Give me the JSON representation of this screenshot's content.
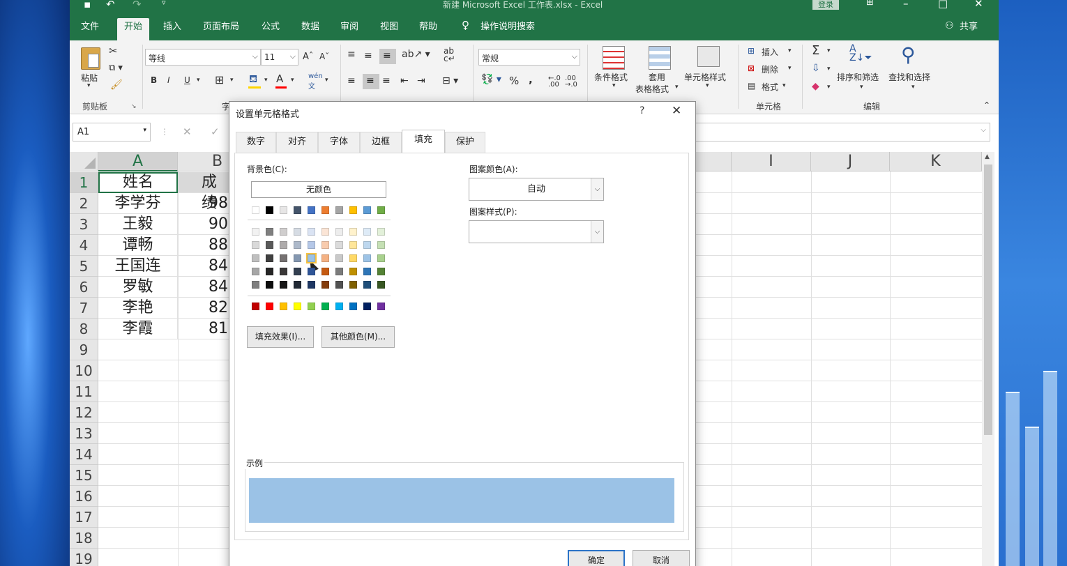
{
  "window": {
    "title": "新建 Microsoft Excel 工作表.xlsx  -  Excel",
    "login": "登录",
    "qat_icons": [
      "save-icon",
      "undo-icon",
      "redo-icon",
      "customize-qat-icon"
    ],
    "controls": [
      "ribbon-display-icon",
      "minimize-icon",
      "maximize-icon",
      "close-icon"
    ]
  },
  "menu": {
    "tabs": [
      "文件",
      "开始",
      "插入",
      "页面布局",
      "公式",
      "数据",
      "审阅",
      "视图",
      "帮助"
    ],
    "active_tab": "开始",
    "tell_me": "操作说明搜索",
    "share": "共享"
  },
  "ribbon": {
    "clipboard": {
      "paste": "粘贴",
      "label": "剪贴板"
    },
    "font": {
      "name": "等线",
      "size": "11",
      "bold": "B",
      "italic": "I",
      "underline": "U"
    },
    "number": {
      "format": "常规",
      "percent": "%",
      "comma": ","
    },
    "styles": {
      "conditional": "条件格式",
      "table_line1": "套用",
      "table_line2": "表格格式",
      "cell_styles": "单元格样式"
    },
    "cells": {
      "insert": "插入",
      "delete": "删除",
      "format": "格式",
      "label": "单元格"
    },
    "editing": {
      "sort_filter": "排序和筛选",
      "find_select": "查找和选择",
      "label": "编辑"
    },
    "partial_label": "字"
  },
  "formula_bar": {
    "name_box": "A1",
    "cancel": "✕",
    "enter": "✓"
  },
  "sheet": {
    "left_columns": [
      "A",
      "B"
    ],
    "right_columns": [
      "I",
      "J",
      "K"
    ],
    "rows": [
      "1",
      "2",
      "3",
      "4",
      "5",
      "6",
      "7",
      "8",
      "9",
      "10",
      "11",
      "12",
      "13",
      "14",
      "15",
      "16",
      "17",
      "18",
      "19"
    ],
    "data": [
      [
        "姓名",
        "成绩"
      ],
      [
        "李学芬",
        "98"
      ],
      [
        "王毅",
        "90"
      ],
      [
        "谭畅",
        "88"
      ],
      [
        "王国连",
        "84"
      ],
      [
        "罗敏",
        "84"
      ],
      [
        "李艳",
        "82"
      ],
      [
        "李霞",
        "81"
      ]
    ]
  },
  "dialog": {
    "title": "设置单元格格式",
    "help": "?",
    "tabs": [
      "数字",
      "对齐",
      "字体",
      "边框",
      "填充",
      "保护"
    ],
    "active_tab": "填充",
    "background_label": "背景色(C):",
    "no_color": "无颜色",
    "pattern_color_label": "图案颜色(A):",
    "pattern_color_value": "自动",
    "pattern_style_label": "图案样式(P):",
    "fill_effects": "填充效果(I)...",
    "more_colors": "其他颜色(M)...",
    "sample_label": "示例",
    "sample_color": "#9bc2e6",
    "ok": "确定",
    "cancel": "取消",
    "palette_top": [
      "#ffffff",
      "#000000",
      "#e7e6e6",
      "#44546a",
      "#4472c4",
      "#ed7d31",
      "#a5a5a5",
      "#ffc000",
      "#5b9bd5",
      "#70ad47"
    ],
    "palette_shades": [
      [
        "#f2f2f2",
        "#7f7f7f",
        "#d0cece",
        "#d6dce4",
        "#dae3f3",
        "#fbe5d6",
        "#ededed",
        "#fff2cc",
        "#deebf7",
        "#e2f0d9"
      ],
      [
        "#d9d9d9",
        "#595959",
        "#aeabab",
        "#adb9ca",
        "#b4c7e7",
        "#f8cbad",
        "#dbdbdb",
        "#ffe699",
        "#bdd7ee",
        "#c5e0b4"
      ],
      [
        "#bfbfbf",
        "#404040",
        "#757171",
        "#8497b0",
        "#9bc2e6",
        "#f4b183",
        "#c9c9c9",
        "#ffd966",
        "#9dc3e6",
        "#a9d18e"
      ],
      [
        "#a6a6a6",
        "#262626",
        "#3a3838",
        "#333f50",
        "#2f5597",
        "#c55a11",
        "#7b7b7b",
        "#bf9000",
        "#2e75b6",
        "#548235"
      ],
      [
        "#7f7f7f",
        "#0d0d0d",
        "#171616",
        "#222a35",
        "#1f3864",
        "#843c0c",
        "#525252",
        "#7f6000",
        "#1f4e79",
        "#385723"
      ]
    ],
    "palette_standard": [
      "#c00000",
      "#ff0000",
      "#ffc000",
      "#ffff00",
      "#92d050",
      "#00b050",
      "#00b0f0",
      "#0070c0",
      "#002060",
      "#7030a0"
    ]
  }
}
